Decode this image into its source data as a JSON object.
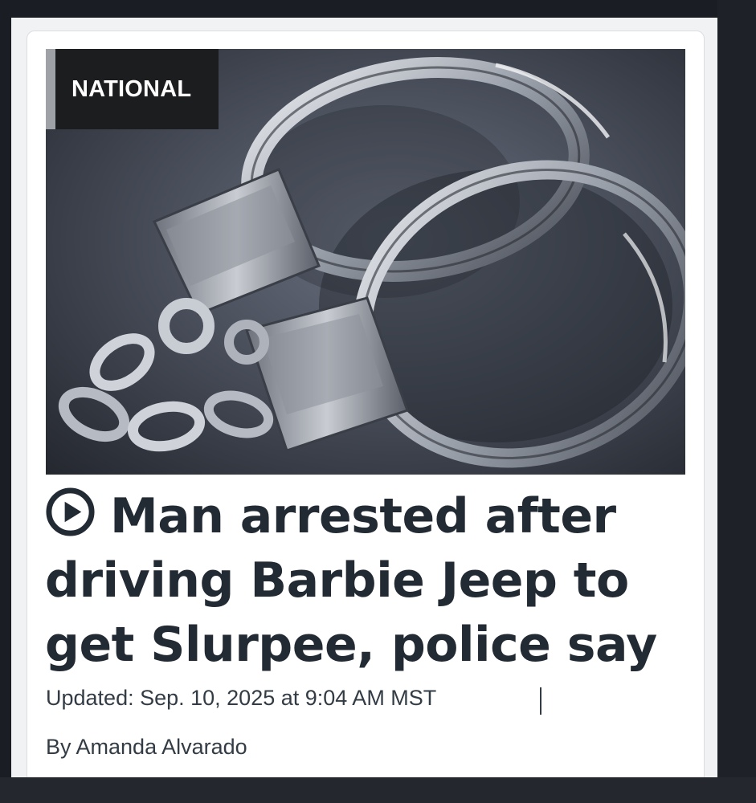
{
  "article": {
    "category": "NATIONAL",
    "headline": "Man arrested after driving Barbie Jeep to get Slurpee, police say",
    "updated": "Updated: Sep. 10, 2025 at 9:04 AM MST",
    "byline": "By Amanda Alvarado"
  },
  "icons": {
    "video": "play-circle-icon"
  },
  "colors": {
    "background": "#1b1d24",
    "card": "#ffffff",
    "tag_background": "#1c1d1f",
    "tag_accent": "#9ea1a6",
    "headline": "#222a33",
    "meta_text": "#333c45"
  }
}
